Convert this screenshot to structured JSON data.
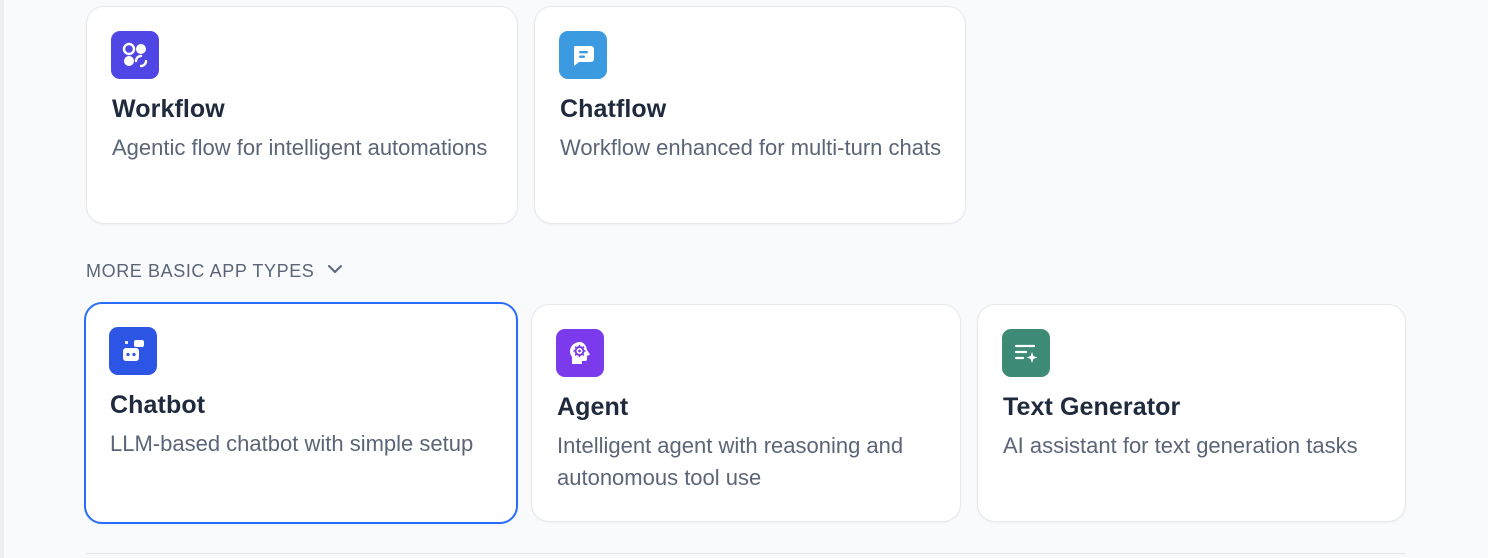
{
  "top_apps": [
    {
      "title": "Workflow",
      "description": "Agentic flow for intelligent automations",
      "icon": "workflow-icon",
      "icon_color": "#4f46e5"
    },
    {
      "title": "Chatflow",
      "description": "Workflow enhanced for multi-turn chats",
      "icon": "chatflow-icon",
      "icon_color": "#3b9ae0"
    }
  ],
  "more_section": {
    "label": "MORE BASIC APP TYPES",
    "icon": "chevron-down-icon"
  },
  "basic_apps": [
    {
      "title": "Chatbot",
      "description": "LLM-based chatbot with simple setup",
      "icon": "chatbot-icon",
      "icon_color": "#2c55e6",
      "selected": true
    },
    {
      "title": "Agent",
      "description": "Intelligent agent with reasoning and autonomous tool use",
      "icon": "agent-icon",
      "icon_color": "#7c3aed"
    },
    {
      "title": "Text Generator",
      "description": "AI assistant for text generation tasks",
      "icon": "text-generator-icon",
      "icon_color": "#3d8b77"
    }
  ],
  "colors": {
    "accent": "#296dff",
    "background": "#f9fafb",
    "title": "#1f2a3d",
    "description": "#5b6577"
  }
}
